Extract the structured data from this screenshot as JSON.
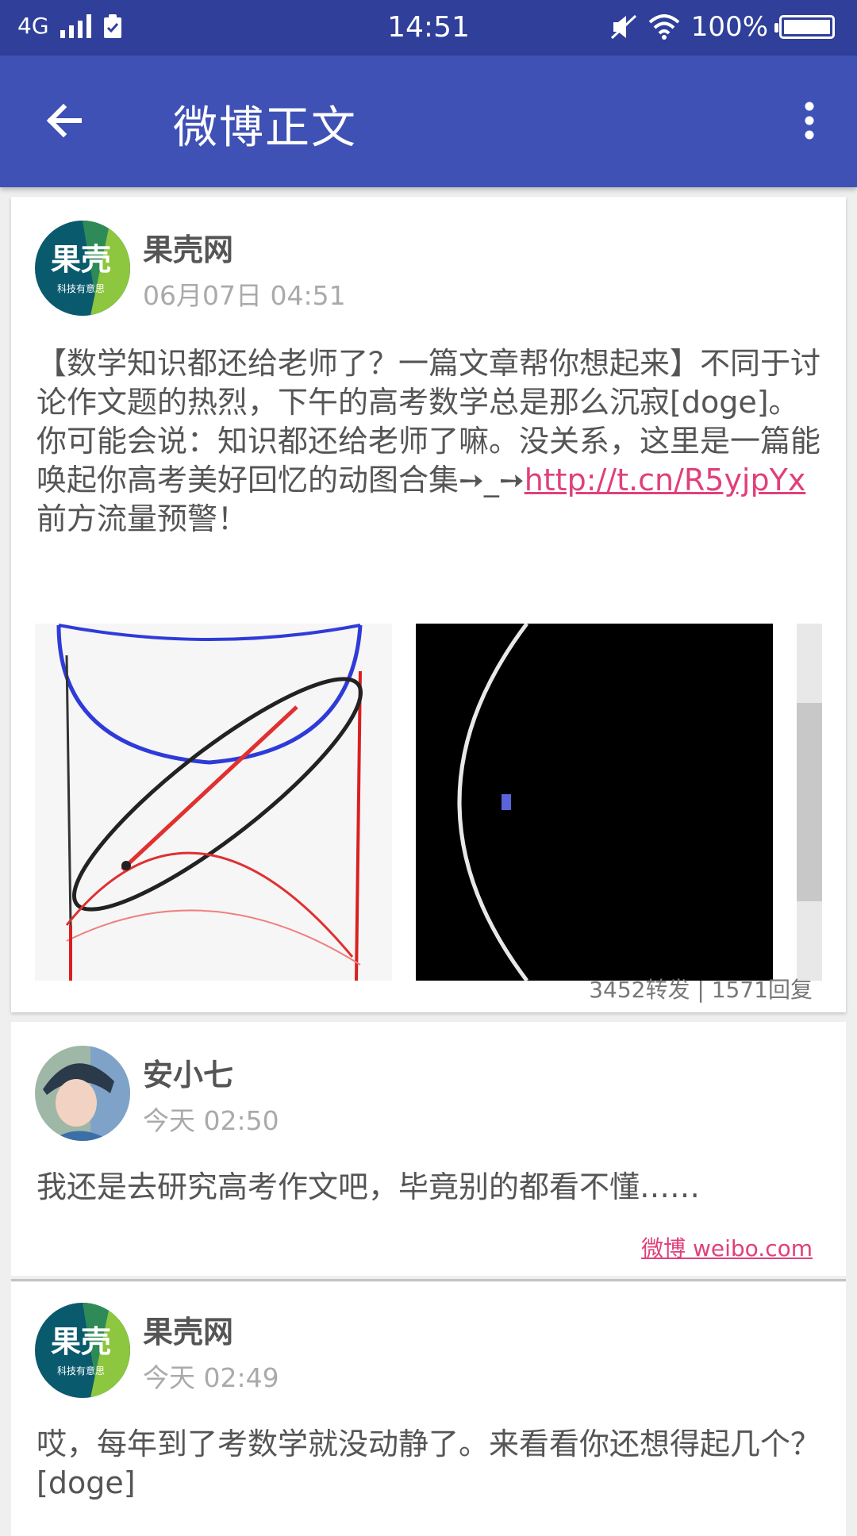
{
  "status_bar": {
    "network": "4G",
    "time": "14:51",
    "battery": "100%"
  },
  "app_bar": {
    "title": "微博正文"
  },
  "main_post": {
    "author": "果壳网",
    "date": "06月07日 04:51",
    "text_before_link": "【数学知识都还给老师了？一篇文章帮你想起来】不同于讨论作文题的热烈，下午的高考数学总是那么沉寂[doge]。你可能会说：知识都还给老师了嘛。没关系，这里是一篇能唤起你高考美好回忆的动图合集➙_➙",
    "link": "http://t.cn/R5yjpYx",
    "text_after_link": " 前方流量预警！",
    "counts": "3452转发 | 1571回复",
    "avatar_text_main": "果壳",
    "avatar_text_sub": "科技有意思"
  },
  "comments": [
    {
      "author": "安小七",
      "date": "今天 02:50",
      "text": "我还是去研究高考作文吧，毕竟别的都看不懂……",
      "source": "微博 weibo.com"
    },
    {
      "author": "果壳网",
      "date": "今天 02:49",
      "text": "哎，每年到了考数学就没动静了。来看看你还想得起几个？[doge]",
      "avatar_text_main": "果壳",
      "avatar_text_sub": "科技有意思"
    }
  ],
  "icons": {
    "back": "arrow-left-icon",
    "more": "more-vertical-icon"
  }
}
